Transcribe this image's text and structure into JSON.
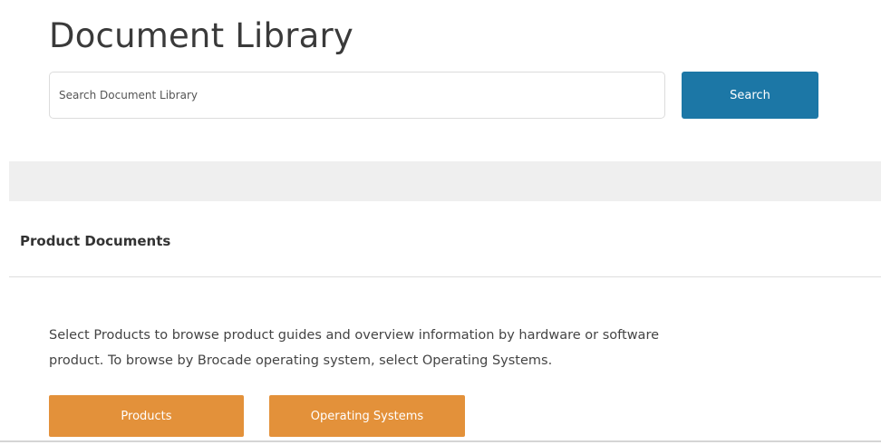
{
  "header": {
    "title": "Document Library"
  },
  "search": {
    "placeholder": "Search Document Library",
    "button_label": "Search"
  },
  "product_documents": {
    "heading": "Product Documents",
    "description_line1": "Select Products to browse product guides and overview information by hardware or software",
    "description_line2": "product. To browse by Brocade operating system, select Operating Systems.",
    "buttons": {
      "products_label": "Products",
      "os_label": "Operating Systems"
    }
  },
  "colors": {
    "search_button": "#1c77a6",
    "category_buttons": "#e3913a",
    "filter_bar": "#efefef"
  }
}
